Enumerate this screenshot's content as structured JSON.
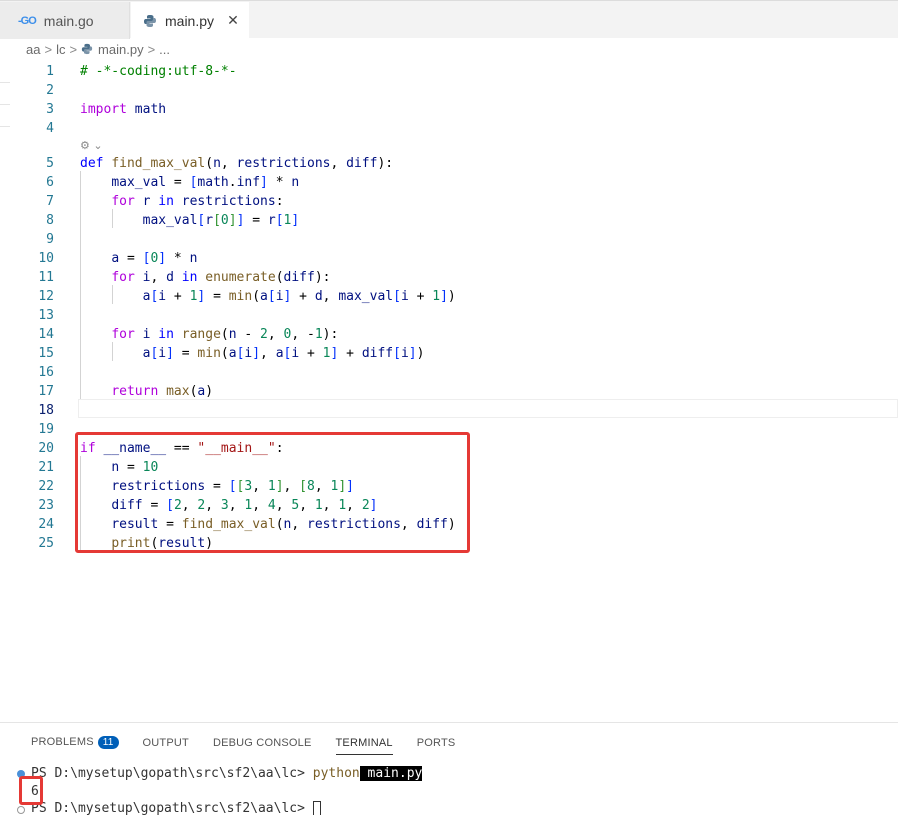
{
  "tabs": [
    {
      "icon": "go-file-icon",
      "icon_text": "-GO",
      "label": "main.go"
    },
    {
      "icon": "python-file-icon",
      "label": "main.py",
      "close": "✕"
    }
  ],
  "breadcrumb": [
    "aa",
    "lc",
    "main.py",
    "..."
  ],
  "codelens": "⚙ ⌄",
  "code_lines": [
    {
      "n": "1",
      "text": "# -*-coding:utf-8-*-"
    },
    {
      "n": "2",
      "text": ""
    },
    {
      "n": "3",
      "text": "import math"
    },
    {
      "n": "4",
      "text": ""
    },
    {
      "n": "5",
      "text": "def find_max_val(n, restrictions, diff):"
    },
    {
      "n": "6",
      "text": "    max_val = [math.inf] * n"
    },
    {
      "n": "7",
      "text": "    for r in restrictions:"
    },
    {
      "n": "8",
      "text": "        max_val[r[0]] = r[1]"
    },
    {
      "n": "9",
      "text": ""
    },
    {
      "n": "10",
      "text": "    a = [0] * n"
    },
    {
      "n": "11",
      "text": "    for i, d in enumerate(diff):"
    },
    {
      "n": "12",
      "text": "        a[i + 1] = min(a[i] + d, max_val[i + 1])"
    },
    {
      "n": "13",
      "text": ""
    },
    {
      "n": "14",
      "text": "    for i in range(n - 2, 0, -1):"
    },
    {
      "n": "15",
      "text": "        a[i] = min(a[i], a[i + 1] + diff[i])"
    },
    {
      "n": "16",
      "text": ""
    },
    {
      "n": "17",
      "text": "    return max(a)"
    },
    {
      "n": "18",
      "text": ""
    },
    {
      "n": "19",
      "text": ""
    },
    {
      "n": "20",
      "text": "if __name__ == \"__main__\":"
    },
    {
      "n": "21",
      "text": "    n = 10"
    },
    {
      "n": "22",
      "text": "    restrictions = [[3, 1], [8, 1]]"
    },
    {
      "n": "23",
      "text": "    diff = [2, 2, 3, 1, 4, 5, 1, 1, 2]"
    },
    {
      "n": "24",
      "text": "    result = find_max_val(n, restrictions, diff)"
    },
    {
      "n": "25",
      "text": "    print(result)"
    }
  ],
  "panel": {
    "tabs": [
      "PROBLEMS",
      "OUTPUT",
      "DEBUG CONSOLE",
      "TERMINAL",
      "PORTS"
    ],
    "problems_count": "11",
    "active_tab": "TERMINAL"
  },
  "terminal": {
    "prompt1": "PS D:\\mysetup\\gopath\\src\\sf2\\aa\\lc> ",
    "cmd": "python",
    "cmd_arg": " main.py",
    "output": "6",
    "prompt2": "PS D:\\mysetup\\gopath\\src\\sf2\\aa\\lc> "
  },
  "colors": {
    "highlight_box": "#e53935",
    "keyword": "#0000ff",
    "control": "#af00db",
    "function": "#795e26",
    "number": "#098658",
    "string": "#a31515",
    "line_number": "#237893"
  }
}
